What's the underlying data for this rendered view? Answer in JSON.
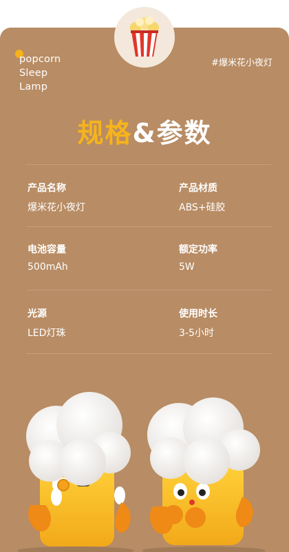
{
  "brand": {
    "line1": "popcorn",
    "line2": "Sleep",
    "line3": "Lamp"
  },
  "tag": "#爆米花小夜灯",
  "heading": {
    "part1": "规格",
    "part2": "&参数"
  },
  "specs": [
    {
      "label": "产品名称",
      "value": "爆米花小夜灯"
    },
    {
      "label": "产品材质",
      "value": "ABS+硅胶"
    },
    {
      "label": "电池容量",
      "value": "500mAh"
    },
    {
      "label": "额定功率",
      "value": "5W"
    },
    {
      "label": "光源",
      "value": "LED灯珠"
    },
    {
      "label": "使用时长",
      "value": "3-5小时"
    }
  ],
  "colors": {
    "background": "#b88c64",
    "accent": "#f6b41c",
    "text": "#ffffff",
    "badge": "#f3e8db"
  },
  "icons": {
    "badge": "popcorn-box-icon"
  }
}
